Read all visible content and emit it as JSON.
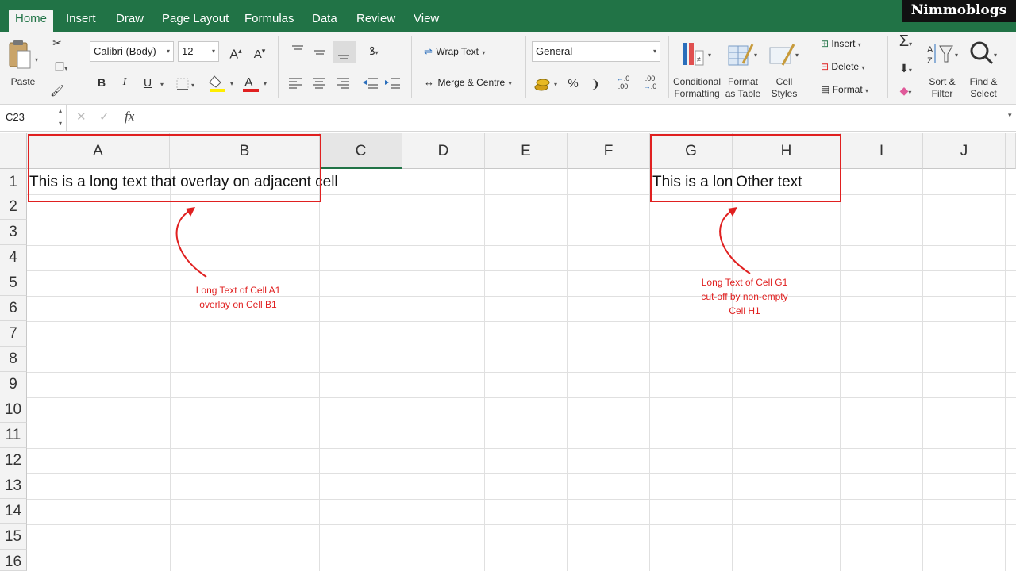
{
  "brand": "Nimmoblogs",
  "tabs": [
    "Home",
    "Insert",
    "Draw",
    "Page Layout",
    "Formulas",
    "Data",
    "Review",
    "View"
  ],
  "ribbon": {
    "paste_label": "Paste",
    "font_name": "Calibri (Body)",
    "font_size": "12",
    "bold": "B",
    "italic": "I",
    "underline": "U",
    "wrap_text": "Wrap Text",
    "merge_centre": "Merge & Centre",
    "number_format": "General",
    "percent": "%",
    "comma": "❩",
    "inc_decimal": ".00",
    "dec_decimal": ".0",
    "conditional_formatting": [
      "Conditional",
      "Formatting"
    ],
    "format_as_table": [
      "Format",
      "as Table"
    ],
    "cell_styles": [
      "Cell",
      "Styles"
    ],
    "insert": "Insert",
    "delete": "Delete",
    "format": "Format",
    "sort_filter": [
      "Sort &",
      "Filter"
    ],
    "find_select": [
      "Find &",
      "Select"
    ],
    "colors": {
      "highlight": "#ffee00",
      "font": "#e02020"
    }
  },
  "formula_bar": {
    "name_box": "C23",
    "fx": "fx",
    "value": ""
  },
  "columns": [
    "A",
    "B",
    "C",
    "D",
    "E",
    "F",
    "G",
    "H",
    "I",
    "J"
  ],
  "rows": [
    "1",
    "2",
    "3",
    "4",
    "5",
    "6",
    "7",
    "8",
    "9",
    "10",
    "11",
    "12",
    "13",
    "14",
    "15",
    "16"
  ],
  "cells": {
    "A1": "This is a long text that overlay on adjacent cell",
    "G1": "This is a long",
    "H1": "Other text"
  },
  "annotations": {
    "left": [
      "Long Text of Cell A1",
      "overlay on Cell B1"
    ],
    "right": [
      "Long Text of Cell G1",
      "cut-off by non-empty",
      "Cell H1"
    ]
  },
  "accent": "#217346",
  "annotation_color": "#e02020"
}
